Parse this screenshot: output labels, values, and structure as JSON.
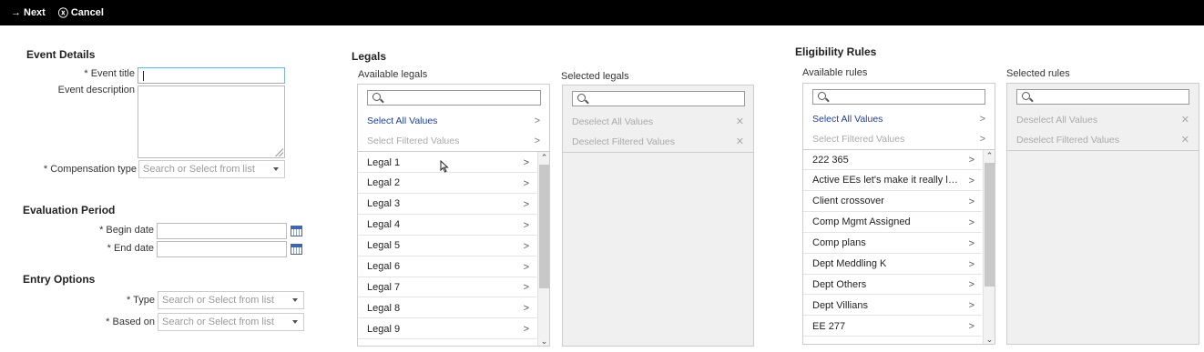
{
  "toolbar": {
    "next_label": "Next",
    "cancel_label": "Cancel"
  },
  "event_details": {
    "heading": "Event Details",
    "event_title_label": "* Event title",
    "event_title_value": "",
    "event_description_label": "Event description",
    "compensation_type_label": "* Compensation type",
    "compensation_type_placeholder": "Search or Select from list"
  },
  "evaluation_period": {
    "heading": "Evaluation Period",
    "begin_date_label": "* Begin date",
    "end_date_label": "* End date"
  },
  "entry_options": {
    "heading": "Entry Options",
    "type_label": "* Type",
    "type_placeholder": "Search or Select from list",
    "based_on_label": "* Based on",
    "based_on_placeholder": "Search or Select from list"
  },
  "legals": {
    "heading": "Legals",
    "available_label": "Available legals",
    "selected_label": "Selected legals",
    "select_all": "Select All Values",
    "select_filtered": "Select Filtered Values",
    "deselect_all": "Deselect All Values",
    "deselect_filtered": "Deselect Filtered Values",
    "items": [
      "Legal 1",
      "Legal 2",
      "Legal 3",
      "Legal 4",
      "Legal 5",
      "Legal 6",
      "Legal 7",
      "Legal 8",
      "Legal 9"
    ]
  },
  "eligibility": {
    "heading": "Eligibility Rules",
    "available_label": "Available rules",
    "selected_label": "Selected rules",
    "select_all": "Select All Values",
    "select_filtered": "Select Filtered Values",
    "deselect_all": "Deselect All Values",
    "deselect_filtered": "Deselect Filtered Values",
    "items": [
      "222 365",
      "Active EEs let's make it really long...",
      "Client crossover",
      "Comp Mgmt Assigned",
      "Comp plans",
      "Dept Meddling K",
      "Dept Others",
      "Dept Villians",
      "EE 277"
    ]
  },
  "icons": {
    "next": "arrow-right-icon",
    "cancel": "circle-x-icon",
    "search": "search-icon",
    "calendar": "calendar-icon",
    "chevron": "chevron-right-icon"
  },
  "colors": {
    "topbar": "#000000",
    "link_blue": "#1a3ea8",
    "focus_border": "#7ab4e6"
  }
}
